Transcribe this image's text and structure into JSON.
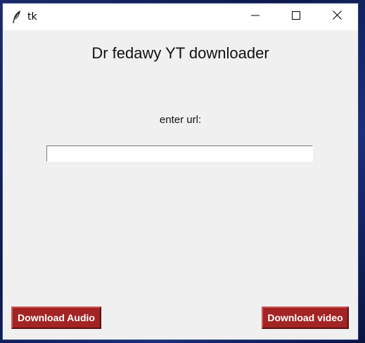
{
  "window": {
    "title": "tk",
    "icon": "feather-icon",
    "controls": {
      "minimize_icon": "minimize-icon",
      "maximize_icon": "maximize-icon",
      "close_icon": "close-icon"
    }
  },
  "main": {
    "heading": "Dr fedawy YT downloader",
    "url_label": "enter url:",
    "url_value": ""
  },
  "buttons": {
    "audio_label": "Download Audio",
    "video_label": "Download video"
  },
  "colors": {
    "button_bg": "#a32424",
    "button_text": "#ffffff",
    "window_bg": "#f0f0f0",
    "titlebar_bg": "#ffffff"
  }
}
